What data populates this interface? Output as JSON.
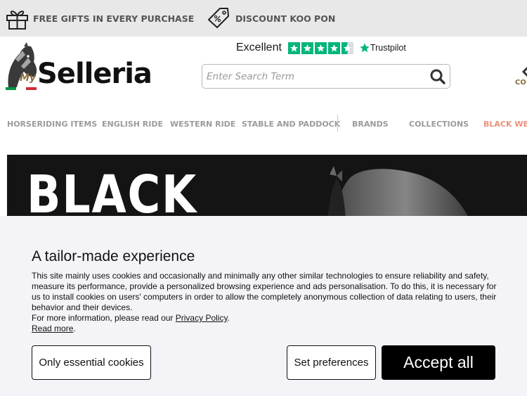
{
  "topbar": {
    "promo_gifts": "FREE GIFTS IN EVERY PURCHASE",
    "promo_discount": "DISCOUNT KOO PON"
  },
  "logo": {
    "prefix": "My",
    "word": "Selleria",
    "flag_colors": [
      "#009246",
      "#ffffff",
      "#ce2b37"
    ]
  },
  "trustpilot": {
    "rating_word": "Excellent",
    "brand": "Trustpilot",
    "stars_filled": 4.5,
    "star_color": "#00b67a"
  },
  "search": {
    "placeholder": "Enter Search Term",
    "value": ""
  },
  "header_right": {
    "label_fragment": "CO"
  },
  "nav": {
    "items": [
      "HORSERIDING ITEMS",
      "ENGLISH RIDE",
      "WESTERN RIDE",
      "STABLE AND PADDOCK",
      "BRANDS",
      "COLLECTIONS",
      "BLACK WEE"
    ],
    "highlight_color": "#e8927a"
  },
  "hero": {
    "title": "BLACK"
  },
  "cookie": {
    "title": "A tailor-made experience",
    "body": "This site mainly uses cookies and occasionally and minimally any other similar technologies to ensure reliability and safety, measure its performance, provide a personalized browsing experience and ads personalisation. To do this, it is necessary for us to install cookies on users' computers in order to allow the completely anonymous collection of data relating to users, their behavior and their devices.",
    "policy_prefix": "For more information, please read our ",
    "policy_link": "Privacy Policy",
    "policy_suffix": ".",
    "read_more": "Read more",
    "read_more_suffix": ".",
    "btn_essential": "Only essential cookies",
    "btn_prefs": "Set preferences",
    "btn_accept": "Accept all"
  }
}
